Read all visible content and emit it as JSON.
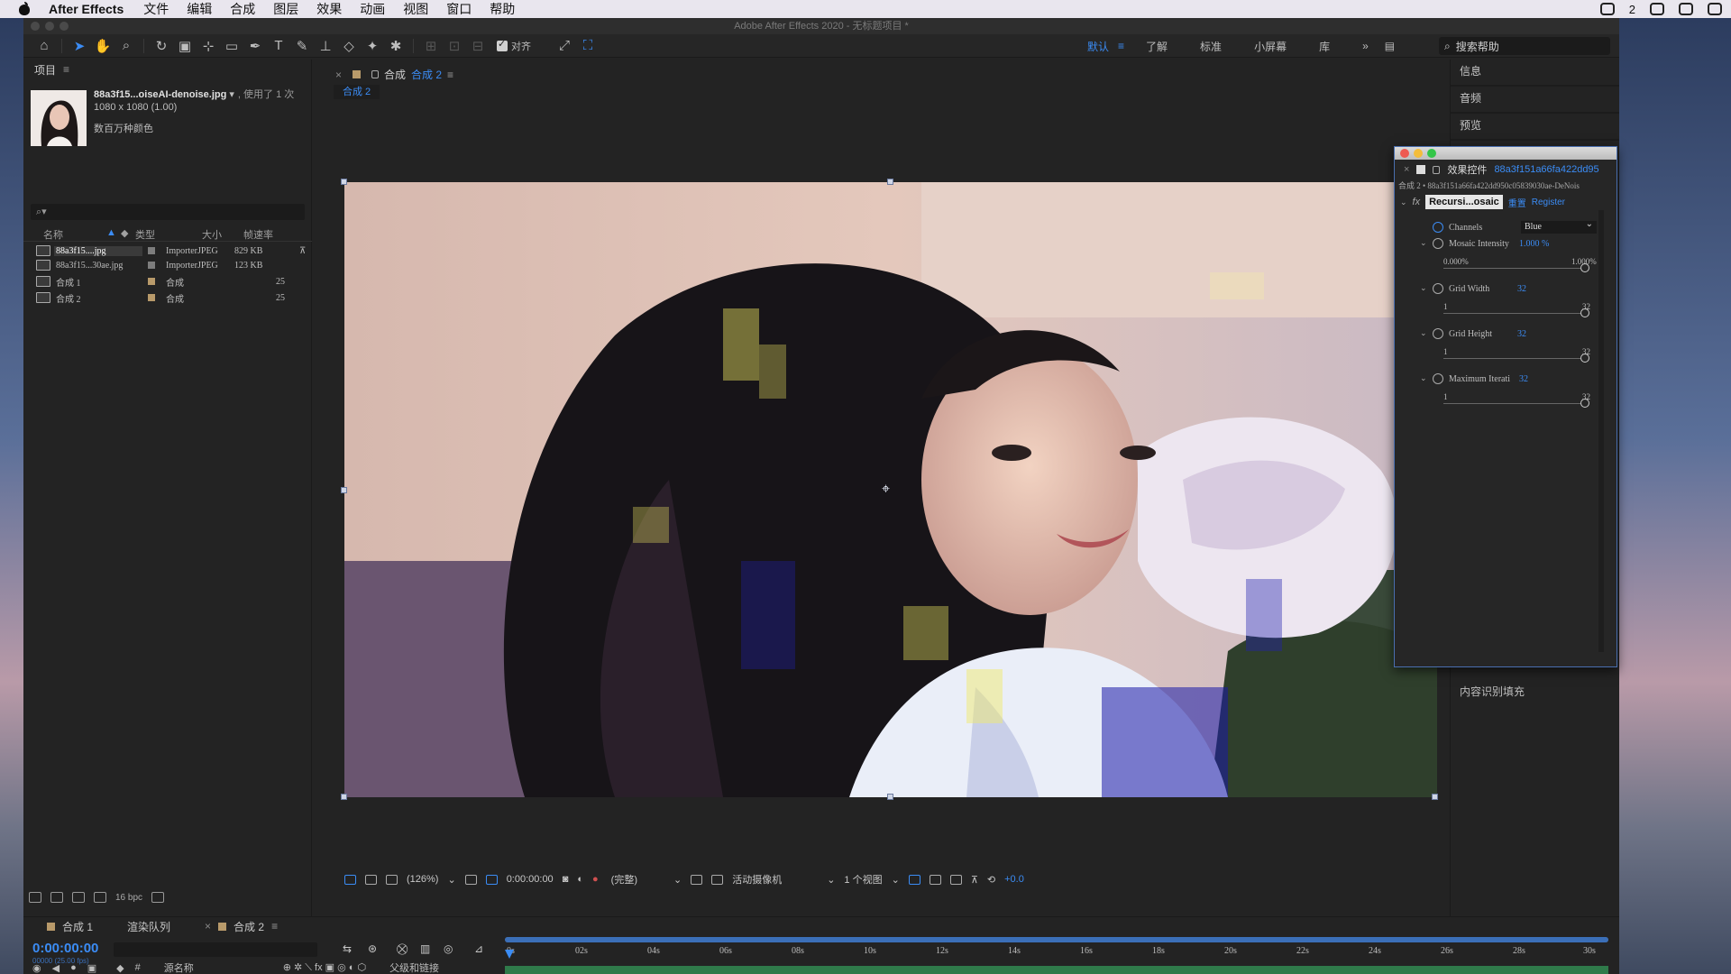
{
  "menubar": {
    "app_name": "After Effects",
    "items": [
      "文件",
      "编辑",
      "合成",
      "图层",
      "效果",
      "动画",
      "视图",
      "窗口",
      "帮助"
    ],
    "tray_count": "2"
  },
  "window": {
    "title": "Adobe After Effects 2020 - 无标题项目 *"
  },
  "toolbar": {
    "align_label": "对齐",
    "workspaces": [
      "默认",
      "了解",
      "标准",
      "小屏幕",
      "库"
    ],
    "active_workspace": "默认",
    "search_help": "搜索帮助"
  },
  "project": {
    "title": "项目",
    "selected_file": "88a3f15...oiseAI-denoise.jpg",
    "used_count": ", 使用了 1 次",
    "dimensions": "1080 x 1080 (1.00)",
    "colors": "数百万种颜色",
    "columns": {
      "name": "名称",
      "type": "类型",
      "size": "大小",
      "rate": "帧速率"
    },
    "rows": [
      {
        "name": "88a3f15....jpg",
        "type": "ImporterJPEG",
        "size": "829 KB",
        "rate": "",
        "label": "#7d7d7d"
      },
      {
        "name": "88a3f15...30ae.jpg",
        "type": "ImporterJPEG",
        "size": "123 KB",
        "rate": "",
        "label": "#7d7d7d"
      },
      {
        "name": "合成 1",
        "type": "合成",
        "size": "",
        "rate": "25",
        "label": "#b89a6a"
      },
      {
        "name": "合成 2",
        "type": "合成",
        "size": "",
        "rate": "25",
        "label": "#b89a6a"
      }
    ],
    "bpc": "16 bpc"
  },
  "composition": {
    "tab_label": "合成",
    "tab_name": "合成 2",
    "sub_tab": "合成 2",
    "footer": {
      "zoom": "(126%)",
      "timecode": "0:00:00:00",
      "quality": "(完整)",
      "camera": "活动摄像机",
      "views": "1 个视图",
      "exposure": "+0.0"
    }
  },
  "right_panels": {
    "items": [
      "信息",
      "音频",
      "预览"
    ],
    "bottom_item": "内容识别填充"
  },
  "effect_controls": {
    "title": "效果控件",
    "layer_name": "88a3f151a66fa422dd95",
    "path": "合成 2 • 88a3f151a66fa422dd950c05839030ae-DeNois",
    "fx_name": "Recursi...osaic",
    "reset": "重置",
    "register": "Register",
    "channels_label": "Channels",
    "channels_value": "Blue",
    "props": [
      {
        "name": "Mosaic Intensity",
        "value": "1.000 %",
        "min": "0.000%",
        "max": "1.000%"
      },
      {
        "name": "Grid Width",
        "value": "32",
        "min": "1",
        "max": "32"
      },
      {
        "name": "Grid Height",
        "value": "32",
        "min": "1",
        "max": "32"
      },
      {
        "name": "Maximum Iterati",
        "value": "32",
        "min": "1",
        "max": "32"
      }
    ]
  },
  "timeline": {
    "tabs": [
      "合成 1",
      "渲染队列",
      "合成 2"
    ],
    "timecode": "0:00:00:00",
    "fps": "00000 (25.00 fps)",
    "col_source": "源名称",
    "col_parent": "父级和链接",
    "ruler": [
      "0s",
      "02s",
      "04s",
      "06s",
      "08s",
      "10s",
      "12s",
      "14s",
      "16s",
      "18s",
      "20s",
      "22s",
      "24s",
      "26s",
      "28s",
      "30s"
    ]
  }
}
